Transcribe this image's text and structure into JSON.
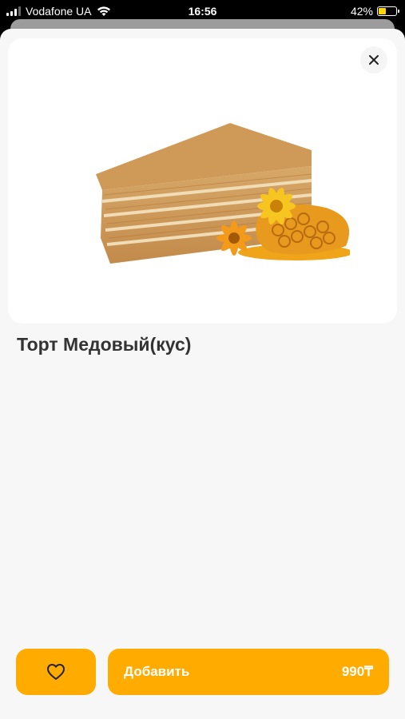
{
  "status_bar": {
    "carrier": "Vodafone UA",
    "time": "16:56",
    "battery_percent": "42%",
    "battery_level": 0.42,
    "battery_color": "#ffd60a"
  },
  "product": {
    "title": "Торт Медовый(кус)",
    "image_icon": "honey-cake-slice"
  },
  "actions": {
    "favorite_icon": "heart-icon",
    "add_label": "Добавить",
    "price": "990₸",
    "accent_color": "#ffab00"
  }
}
